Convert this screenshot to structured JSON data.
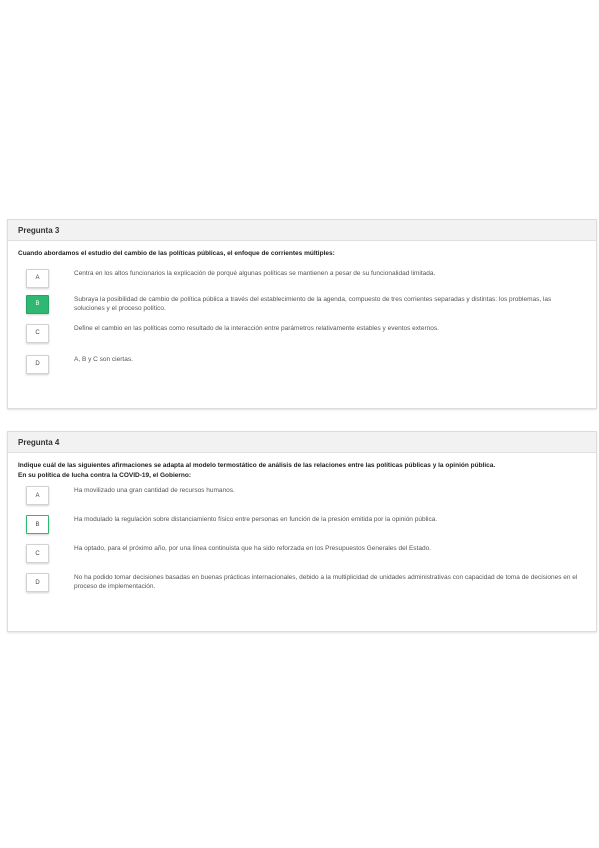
{
  "q3": {
    "header": "Pregunta 3",
    "question": "Cuando abordamos el estudio del cambio de las políticas públicas, el enfoque de corrientes múltiples:",
    "options": [
      {
        "letter": "A",
        "text": "Centra en los altos funcionarios la explicación de porqué algunas políticas se mantienen a pesar de su funcionalidad limitada."
      },
      {
        "letter": "B",
        "text": "Subraya la posibilidad de cambio de política pública a través del establecimiento de la agenda, compuesto de tres corrientes separadas y distintas: los problemas, las soluciones y el proceso político."
      },
      {
        "letter": "C",
        "text": "Define el cambio en las políticas como resultado de la interacción entre parámetros relativamente estables y eventos externos."
      },
      {
        "letter": "D",
        "text": "A, B y C son ciertas."
      }
    ],
    "selected": "B"
  },
  "q4": {
    "header": "Pregunta 4",
    "question_line1": "Indique cuál de las siguientes afirmaciones se adapta al modelo termostático de análisis de las relaciones entre las políticas públicas y la opinión pública.",
    "question_line2": "En su política de lucha contra la COVID-19, el Gobierno:",
    "options": [
      {
        "letter": "A",
        "text": "Ha movilizado una gran cantidad de recursos humanos."
      },
      {
        "letter": "B",
        "text": "Ha modulado la regulación sobre distanciamiento físico entre personas en función de la presión emitida por la opinión pública."
      },
      {
        "letter": "C",
        "text": "Ha optado, para el próximo año, por una línea continuista que ha sido reforzada en los Presupuestos Generales del Estado."
      },
      {
        "letter": "D",
        "text": "No ha podido tomar decisiones basadas en buenas prácticas internacionales, debido a la multiplicidad de unidades administrativas con capacidad de toma de decisiones en el proceso de implementación."
      }
    ],
    "selected": "B"
  },
  "colors": {
    "accent": "#2eb872"
  }
}
